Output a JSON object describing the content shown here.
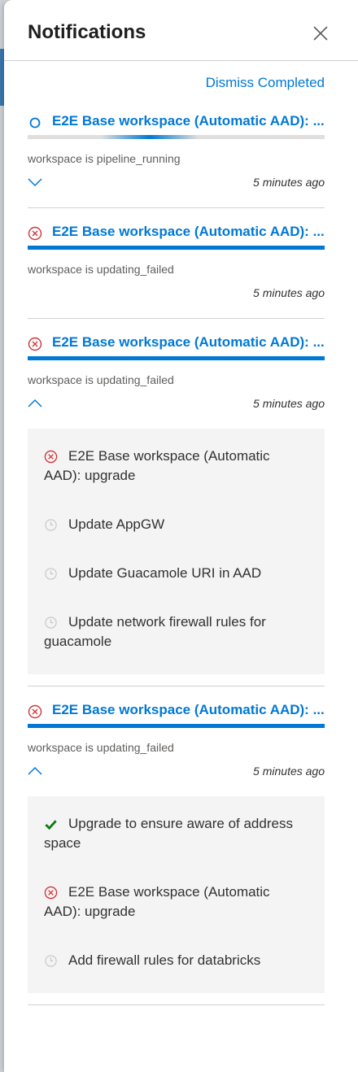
{
  "panel": {
    "title": "Notifications",
    "dismiss_label": "Dismiss Completed"
  },
  "colors": {
    "accent": "#0078d4",
    "error": "#d13438",
    "success": "#107c10",
    "pending": "#c8c6c4"
  },
  "notifications": [
    {
      "state": "running",
      "icon": "spinner-icon",
      "title": "E2E Base workspace (Automatic AAD): ...",
      "status": "workspace is pipeline_running",
      "time": "5 minutes ago",
      "chevron": "chevron-down-icon",
      "expanded": false,
      "steps": []
    },
    {
      "state": "failed",
      "icon": "error-circle-icon",
      "title": "E2E Base workspace (Automatic AAD): ...",
      "status": "workspace is updating_failed",
      "time": "5 minutes ago",
      "chevron": null,
      "expanded": false,
      "steps": []
    },
    {
      "state": "failed",
      "icon": "error-circle-icon",
      "title": "E2E Base workspace (Automatic AAD): ...",
      "status": "workspace is updating_failed",
      "time": "5 minutes ago",
      "chevron": "chevron-up-icon",
      "expanded": true,
      "steps": [
        {
          "icon": "error-circle-icon",
          "label": "E2E Base workspace (Automatic AAD): upgrade"
        },
        {
          "icon": "clock-icon",
          "label": "Update AppGW"
        },
        {
          "icon": "clock-icon",
          "label": "Update Guacamole URI in AAD"
        },
        {
          "icon": "clock-icon",
          "label": "Update network firewall rules for guacamole"
        }
      ]
    },
    {
      "state": "failed",
      "icon": "error-circle-icon",
      "title": "E2E Base workspace (Automatic AAD): ...",
      "status": "workspace is updating_failed",
      "time": "5 minutes ago",
      "chevron": "chevron-up-icon",
      "expanded": true,
      "steps": [
        {
          "icon": "checkmark-icon",
          "label": "Upgrade to ensure aware of address space"
        },
        {
          "icon": "error-circle-icon",
          "label": "E2E Base workspace (Automatic AAD): upgrade"
        },
        {
          "icon": "clock-icon",
          "label": "Add firewall rules for databricks"
        }
      ]
    }
  ]
}
